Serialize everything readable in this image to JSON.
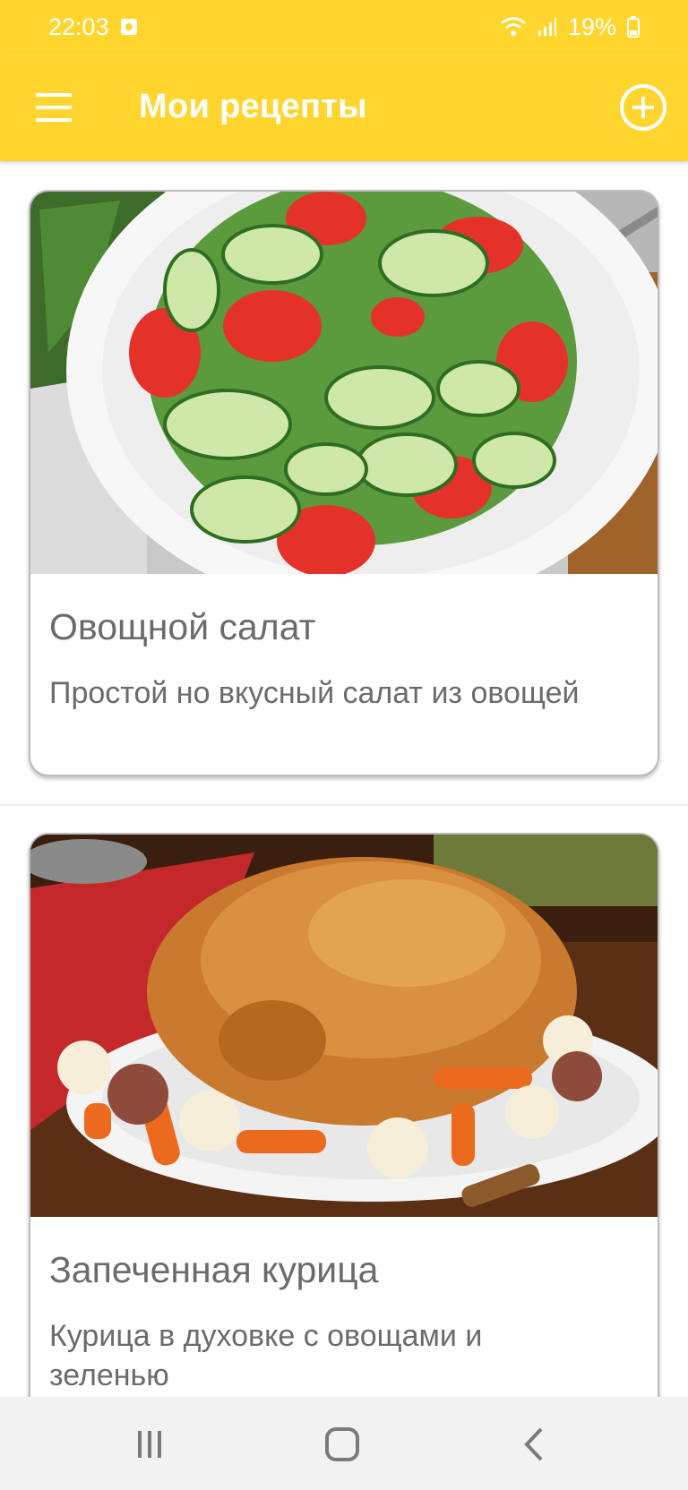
{
  "status_bar": {
    "time": "22:03",
    "battery": "19%"
  },
  "app_bar": {
    "title": "Мои рецепты"
  },
  "recipes": [
    {
      "title": "Овощной салат",
      "description": "Простой но вкусный салат из овощей",
      "image": "vegetable-salad-photo"
    },
    {
      "title": "Запеченная курица",
      "description": "Курица в духовке с овощами и зеленью",
      "image": "roast-chicken-photo"
    }
  ],
  "colors": {
    "accent": "#FFD52E",
    "text_secondary": "#6b6b6b",
    "nav_bar": "#f2f2f2"
  },
  "icons": [
    "menu-icon",
    "add-circle-icon",
    "recent-apps-icon",
    "home-icon",
    "back-icon",
    "wifi-icon",
    "signal-icon",
    "battery-icon",
    "notification-icon"
  ]
}
